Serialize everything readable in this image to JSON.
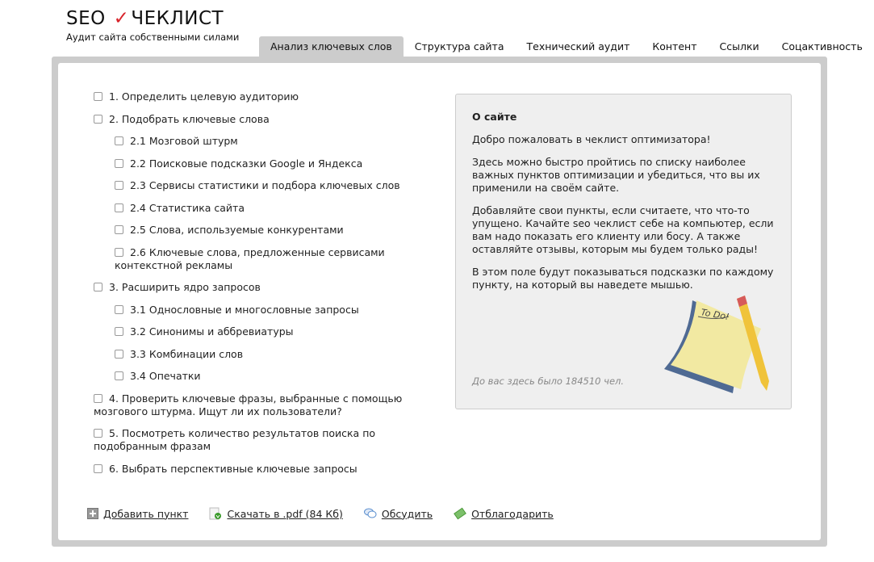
{
  "header": {
    "logo_left": "SEO",
    "logo_check": "✓",
    "logo_right": "ЧЕКЛИСТ",
    "tagline": "Аудит сайта собственными силами"
  },
  "tabs": [
    {
      "label": "Анализ ключевых слов",
      "active": true
    },
    {
      "label": "Структура сайта"
    },
    {
      "label": "Технический аудит"
    },
    {
      "label": "Контент"
    },
    {
      "label": "Ссылки"
    },
    {
      "label": "Соцактивность"
    }
  ],
  "checklist": [
    {
      "label": "1. Определить целевую аудиторию",
      "level": 0
    },
    {
      "label": "2. Подобрать ключевые слова",
      "level": 0
    },
    {
      "label": "2.1 Мозговой штурм",
      "level": 1
    },
    {
      "label": "2.2 Поисковые подсказки Google и Яндекса",
      "level": 1
    },
    {
      "label": "2.3 Сервисы статистики и подбора ключевых слов",
      "level": 1
    },
    {
      "label": "2.4 Статистика сайта",
      "level": 1
    },
    {
      "label": "2.5 Слова, используемые конкурентами",
      "level": 1
    },
    {
      "label": "2.6 Ключевые слова, предложенные сервисами контекстной рекламы",
      "level": 1
    },
    {
      "label": "3. Расширить ядро запросов",
      "level": 0
    },
    {
      "label": "3.1 Однословные и многословные запросы",
      "level": 1
    },
    {
      "label": "3.2 Синонимы и аббревиатуры",
      "level": 1
    },
    {
      "label": "3.3 Комбинации слов",
      "level": 1
    },
    {
      "label": "3.4 Опечатки",
      "level": 1
    },
    {
      "label": "4. Проверить ключевые фразы, выбранные с помощью мозгового штурма. Ищут ли их пользователи?",
      "level": 0
    },
    {
      "label": "5. Посмотреть количество результатов поиска по подобранным фразам",
      "level": 0
    },
    {
      "label": "6. Выбрать перспективные ключевые запросы",
      "level": 0
    }
  ],
  "info": {
    "title": "О сайте",
    "paragraphs": [
      "Добро пожаловать в чеклист оптимизатора!",
      "Здесь можно быстро пройтись по списку наиболее важных пунктов оптимизации и убедиться, что вы их применили на своём сайте.",
      "Добавляйте свои пункты, если считаете, что что-то упущено. Качайте seo чеклист себе на компьютер, если вам надо показать его клиенту или босу. А также оставляйте отзывы, которым мы будем только рады!",
      "В этом поле будут показываться подсказки по каждому пункту, на который вы наведете мышью."
    ],
    "visits": "До вас здесь было 184510 чел.",
    "note_text": "To Do!"
  },
  "actions": [
    {
      "label": "Добавить пункт",
      "icon": "plus-icon"
    },
    {
      "label": "Скачать в .pdf (84 Кб)",
      "icon": "download-icon"
    },
    {
      "label": "Обсудить",
      "icon": "chat-icon"
    },
    {
      "label": "Отблагодарить",
      "icon": "money-icon"
    }
  ]
}
